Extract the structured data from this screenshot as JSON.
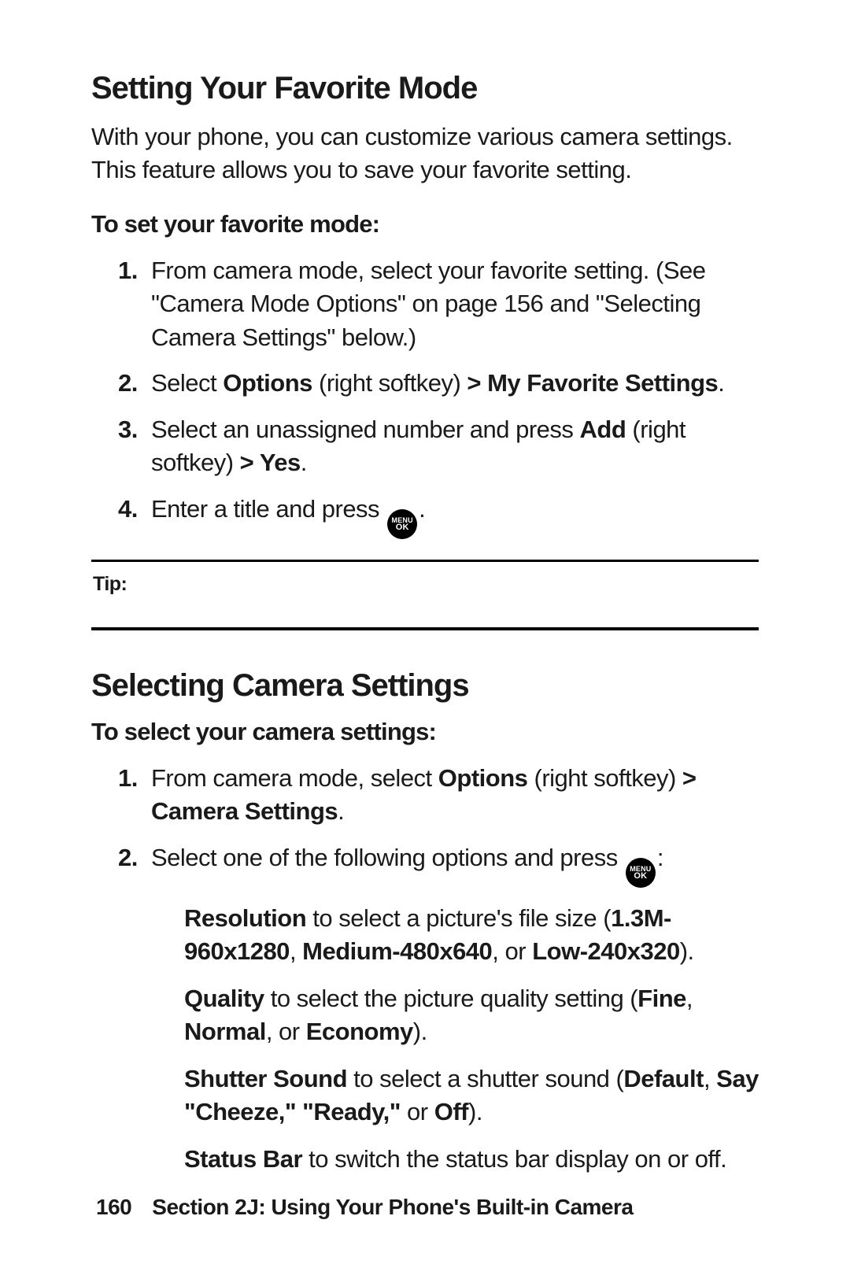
{
  "sectionA": {
    "heading": "Setting Your Favorite Mode",
    "intro": "With your phone, you can customize various camera settings. This feature allows you to save your favorite setting.",
    "lead": "To set your favorite mode:",
    "step1": "From camera mode, select your favorite setting. (See \"Camera Mode Options\" on page 156 and \"Selecting Camera Settings\" below.)",
    "step2_a": "Select ",
    "step2_b": "Options",
    "step2_c": " (right softkey) ",
    "step2_d": "> My Favorite Settings",
    "step2_e": ".",
    "step3_a": "Select an unassigned number and press ",
    "step3_b": "Add",
    "step3_c": " (right softkey) ",
    "step3_d": "> Yes",
    "step3_e": ".",
    "step4_a": "Enter a title and press ",
    "step4_b": "."
  },
  "tip_label": "Tip:",
  "sectionB": {
    "heading": "Selecting Camera Settings",
    "lead": "To select your camera settings:",
    "step1_a": "From camera mode, select ",
    "step1_b": "Options",
    "step1_c": " (right softkey) ",
    "step1_d": "> Camera Settings",
    "step1_e": ".",
    "step2_a": "Select one of the following options and press ",
    "step2_b": ":",
    "res_a": "Resolution",
    "res_b": " to select a picture's file size (",
    "res_c": "1.3M-960x1280",
    "res_d": ", ",
    "res_e": "Medium-480x640",
    "res_f": ", or ",
    "res_g": "Low-240x320",
    "res_h": ").",
    "qual_a": "Quality",
    "qual_b": " to select the picture quality setting (",
    "qual_c": "Fine",
    "qual_d": ", ",
    "qual_e": "Normal",
    "qual_f": ", or ",
    "qual_g": "Economy",
    "qual_h": ").",
    "shut_a": "Shutter Sound",
    "shut_b": " to select a shutter sound (",
    "shut_c": "Default",
    "shut_d": ", ",
    "shut_e": "Say \"Cheeze",
    "shut_f": ",\" \"",
    "shut_g": "Ready",
    "shut_h": ",\"",
    "shut_i": " or ",
    "shut_j": "Off",
    "shut_k": ").",
    "stat_a": "Status Bar",
    "stat_b": " to switch the status bar display on or off."
  },
  "footer": {
    "page": "160",
    "label": "Section 2J: Using Your Phone's Built-in Camera"
  },
  "icon": {
    "top": "MENU",
    "bot": "OK"
  }
}
